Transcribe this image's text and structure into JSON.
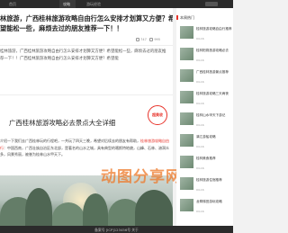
{
  "topbar": {
    "items": [
      "首页",
      "攻略",
      "游玩经验"
    ]
  },
  "article": {
    "title": "林旅游，广西桂林旅游攻略自由行怎么安排才划算又方便？希望能松一些，麻烦去过的朋友推荐一下！！",
    "views": "747",
    "likes": "995",
    "summary": "桂林旅游，广西桂林旅游攻略自由行怎么安排才划算又方便？希望能松一些，麻烦去过的朋友推荐一下！！广西桂林旅游攻略自由行怎么安排才划算又方便？希望能"
  },
  "card": {
    "title": "广西桂林旅游攻略必去景点大全详细",
    "badge": "超美收",
    "body_prefix": "介绍一下我们去广西桂林玩的行程吧，一共玩了四天三晚，希望对后续去的朋友有帮助，",
    "body_highlight": "桂林旅游攻略自由行",
    "body_suffix": "：中国西南，广西壮族自治区东北部，是著名的山水之城，具有典型的喀斯特地貌，山峰、石林、溶洞众多，风景秀丽，被誉为桂林山水甲天下。"
  },
  "watermark": {
    "text": "动图分享网"
  },
  "sidebar": {
    "header": "本周热门",
    "items": [
      {
        "title": "桂林旅游攻略自由行推荐",
        "date": "04-16"
      },
      {
        "title": "桂林阳朔旅游攻略必去",
        "date": "04-16"
      },
      {
        "title": "广西桂林旅游景点推荐",
        "date": "04-16"
      },
      {
        "title": "桂林旅游攻略三天两夜",
        "date": "04-16"
      },
      {
        "title": "桂林山水甲天下游记",
        "date": "04-16"
      },
      {
        "title": "漓江游船攻略",
        "date": "04-16"
      },
      {
        "title": "桂林美食推荐",
        "date": "04-16"
      },
      {
        "title": "桂林旅游住宿推荐",
        "date": "04-16"
      },
      {
        "title": "龙脊梯田游玩攻略",
        "date": "04-16"
      }
    ]
  },
  "footer": {
    "text": "备案号 [ICP]123456号 关于"
  }
}
